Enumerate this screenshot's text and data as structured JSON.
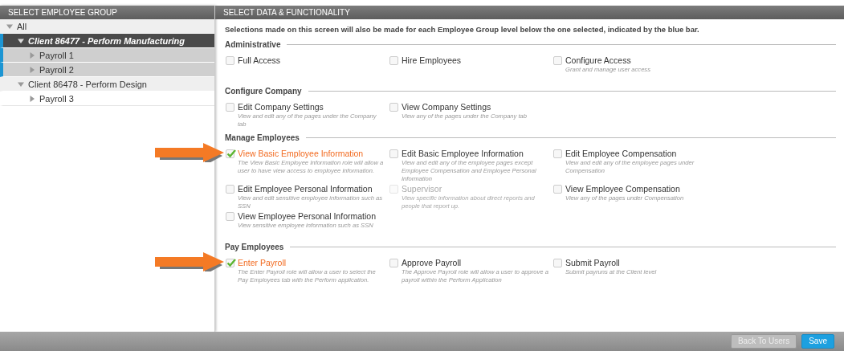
{
  "left_panel": {
    "title": "SELECT EMPLOYEE GROUP",
    "tree": [
      {
        "label": "All",
        "expanded": true,
        "selected": false,
        "in_scope": false,
        "children": [
          {
            "label": "Client 86477 - Perform Manufacturing",
            "expanded": true,
            "selected": true,
            "in_scope": true,
            "children": [
              {
                "label": "Payroll 1",
                "expanded": false,
                "selected": false,
                "in_scope": true
              },
              {
                "label": "Payroll 2",
                "expanded": false,
                "selected": false,
                "in_scope": true
              }
            ]
          },
          {
            "label": "Client 86478 - Perform Design",
            "expanded": true,
            "selected": false,
            "in_scope": false,
            "children": [
              {
                "label": "Payroll 3",
                "expanded": false,
                "selected": false,
                "in_scope": false
              }
            ]
          }
        ]
      }
    ]
  },
  "right_panel": {
    "title": "SELECT DATA & FUNCTIONALITY",
    "intro": "Selections made on this screen will also be made for each Employee Group level below the one selected, indicated by the blue bar.",
    "sections": [
      {
        "title": "Administrative",
        "options": [
          {
            "label": "Full Access",
            "checked": false,
            "disabled": false,
            "pointer": false
          },
          {
            "label": "Hire Employees",
            "checked": false,
            "disabled": false,
            "pointer": false
          },
          {
            "label": "Configure Access",
            "description": "Grant and manage user access",
            "checked": false,
            "disabled": false,
            "pointer": false
          }
        ]
      },
      {
        "title": "Configure Company",
        "options": [
          {
            "label": "Edit Company Settings",
            "description": "View and edit any of the pages under the Company tab",
            "checked": false,
            "disabled": false,
            "pointer": false
          },
          {
            "label": "View Company Settings",
            "description": "View any of the pages under the Company tab",
            "checked": false,
            "disabled": false,
            "pointer": false
          }
        ]
      },
      {
        "title": "Manage Employees",
        "options": [
          {
            "label": "View Basic Employee Information",
            "description": "The View Basic Employee Information role will allow a user to have view access to employee information.",
            "checked": true,
            "disabled": false,
            "pointer": true
          },
          {
            "label": "Edit Basic Employee Information",
            "description": "View and edit any of the employee pages except Employee Compensation and Employee Personal Information",
            "checked": false,
            "disabled": false,
            "pointer": false
          },
          {
            "label": "Edit Employee Compensation",
            "description": "View and edit any of the employee pages under Compensation",
            "checked": false,
            "disabled": false,
            "pointer": false
          },
          {
            "label": "Edit Employee Personal Information",
            "description": "View and edit sensitive employee information such as SSN",
            "checked": false,
            "disabled": false,
            "pointer": false
          },
          {
            "label": "Supervisor",
            "description": "View specific information about direct reports and people that report up.",
            "checked": false,
            "disabled": true,
            "pointer": false
          },
          {
            "label": "View Employee Compensation",
            "description": "View any of the pages under Compensation",
            "checked": false,
            "disabled": false,
            "pointer": false
          },
          {
            "label": "View Employee Personal Information",
            "description": "View sensitive employee information such as SSN",
            "checked": false,
            "disabled": false,
            "pointer": false
          }
        ]
      },
      {
        "title": "Pay Employees",
        "options": [
          {
            "label": "Enter Payroll",
            "description": "The Enter Payroll role will allow a user to select the Pay Employees tab with the Perform application.",
            "checked": true,
            "disabled": false,
            "pointer": true
          },
          {
            "label": "Approve Payroll",
            "description": "The Approve Payroll role will allow a user to approve a payroll within the Perform Application",
            "checked": false,
            "disabled": false,
            "pointer": false
          },
          {
            "label": "Submit Payroll",
            "description": "Submit payruns at the Client level",
            "checked": false,
            "disabled": false,
            "pointer": false
          }
        ]
      }
    ]
  },
  "footer": {
    "buttons": [
      {
        "label": "Back To Users",
        "kind": "secondary"
      },
      {
        "label": "Save",
        "kind": "primary"
      }
    ]
  }
}
